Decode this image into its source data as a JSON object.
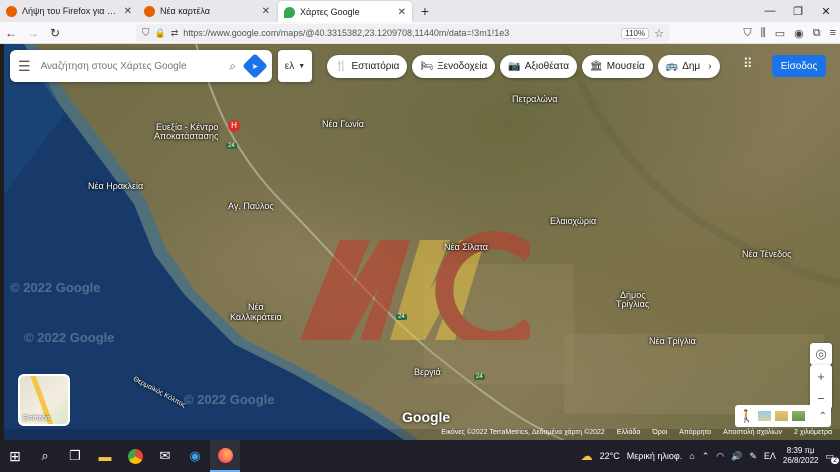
{
  "browser": {
    "tabs": [
      {
        "title": "Λήψη του Firefox για Android κ",
        "favicon_color": "#e66000",
        "active": false
      },
      {
        "title": "Νέα καρτέλα",
        "favicon_color": "#e66000",
        "active": false
      },
      {
        "title": "Χάρτες Google",
        "favicon_color": "#34a853",
        "active": true
      }
    ],
    "new_tab_label": "+",
    "url": "https://www.google.com/maps/@40.3315382,23.1209708,11440m/data=!3m1!1e3",
    "zoom_level": "110%"
  },
  "maps": {
    "search_placeholder": "Αναζήτηση στους Χάρτες Google",
    "language_label": "ελ",
    "chips": [
      {
        "label": "Εστιατόρια",
        "icon": "fork-knife-icon",
        "glyph": "🍴"
      },
      {
        "label": "Ξενοδοχεία",
        "icon": "bed-icon",
        "glyph": "🛏"
      },
      {
        "label": "Αξιοθέατα",
        "icon": "camera-icon",
        "glyph": "📷"
      },
      {
        "label": "Μουσεία",
        "icon": "museum-icon",
        "glyph": "🏛"
      },
      {
        "label": "Δημ",
        "icon": "bus-icon",
        "glyph": "🚌"
      }
    ],
    "sign_in_label": "Είσοδος",
    "layer_label": "Επίπεδα",
    "google_logo": "Google",
    "labels": [
      {
        "text": "Πετραλώνα",
        "id": "petralona"
      },
      {
        "text": "Νέα Γωνία",
        "id": "nea-gonia"
      },
      {
        "text": "Ευεξία - Κέντρο",
        "id": "euexia-1"
      },
      {
        "text": "Αποκατάστασης",
        "id": "euexia-2"
      },
      {
        "text": "Νέα Ηρακλεία",
        "id": "nea-irakleia"
      },
      {
        "text": "Αγ. Παύλος",
        "id": "ag-pavlos"
      },
      {
        "text": "Ελαιοχώρια",
        "id": "elaiochoria"
      },
      {
        "text": "Νέα Σίλατα",
        "id": "nea-silata"
      },
      {
        "text": "Νέα Τένεδος",
        "id": "nea-tenedos"
      },
      {
        "text": "Νέα",
        "id": "nea-kal-1"
      },
      {
        "text": "Καλλικράτεια",
        "id": "nea-kal-2"
      },
      {
        "text": "Δήμος",
        "id": "dimos-1"
      },
      {
        "text": "Τρίγλιας",
        "id": "dimos-2"
      },
      {
        "text": "Νέα Τρίγλια",
        "id": "nea-triglia"
      },
      {
        "text": "Βεργιά",
        "id": "vergia"
      },
      {
        "text": "Θερμαϊκός Κόλπος",
        "id": "thermaikos"
      }
    ],
    "road_shields": [
      "24",
      "24",
      "24"
    ],
    "watermarks": [
      "© 2022 Google",
      "© 2022 Google",
      "© 2022 Google"
    ],
    "attribution": [
      "Εικόνες ©2022 TerraMetrics, Δεδομένα χάρτη ©2022",
      "Ελλάδα",
      "Όροι",
      "Απόρρητο",
      "Αποστολή σχολίων",
      "2 χιλιόμετρα"
    ]
  },
  "taskbar": {
    "temperature": "22°C",
    "weather": "Μερική ηλιοφ.",
    "language": "ΕΛ",
    "time": "8:39 πμ",
    "date": "26/8/2022",
    "notifications": "2"
  }
}
